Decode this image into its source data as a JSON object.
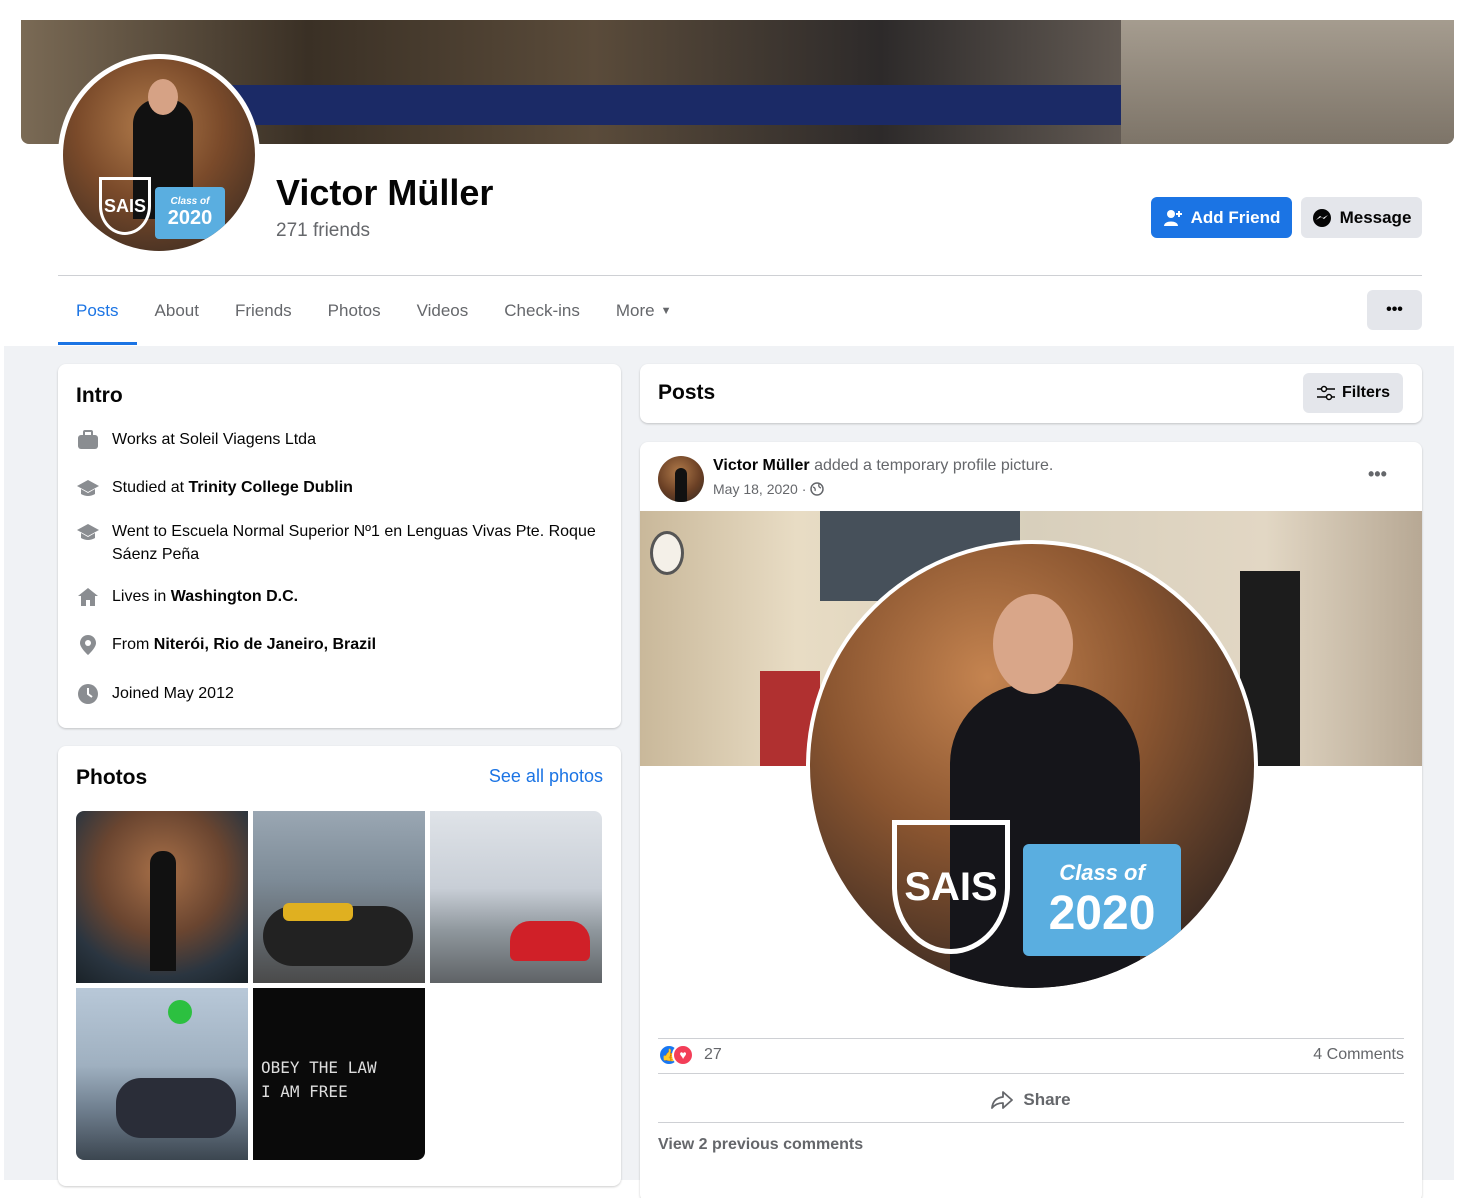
{
  "profile": {
    "name": "Victor Müller",
    "friends": "271 friends",
    "add_friend": "Add Friend",
    "message": "Message"
  },
  "badge": {
    "sais": "SAIS",
    "class_of": "Class of",
    "year": "2020"
  },
  "tabs": [
    {
      "label": "Posts",
      "active": true
    },
    {
      "label": "About"
    },
    {
      "label": "Friends"
    },
    {
      "label": "Photos"
    },
    {
      "label": "Videos"
    },
    {
      "label": "Check-ins"
    },
    {
      "label": "More"
    }
  ],
  "more_dots": "•••",
  "intro": {
    "title": "Intro",
    "items": [
      {
        "icon": "briefcase-icon",
        "prefix": "Works at Soleil Viagens Ltda",
        "bold": ""
      },
      {
        "icon": "graduation-cap-icon",
        "prefix": "Studied at ",
        "bold": "Trinity College Dublin"
      },
      {
        "icon": "graduation-cap-icon",
        "prefix": "Went to Escuela Normal Superior Nº1 en Lenguas Vivas Pte. Roque Sáenz Peña",
        "bold": ""
      },
      {
        "icon": "home-icon",
        "prefix": "Lives in ",
        "bold": "Washington D.C."
      },
      {
        "icon": "location-pin-icon",
        "prefix": "From ",
        "bold": "Niterói, Rio de Janeiro, Brazil"
      },
      {
        "icon": "clock-icon",
        "prefix": "Joined May 2012",
        "bold": ""
      }
    ]
  },
  "photos": {
    "title": "Photos",
    "see_all": "See all photos",
    "poster_lines": [
      "OBEY THE LAW",
      "I AM FREE"
    ]
  },
  "posts": {
    "title": "Posts",
    "filters": "Filters"
  },
  "post": {
    "author": "Victor Müller",
    "action": " added a temporary profile picture.",
    "date": "May 18, 2020 ·",
    "reaction_count": "27",
    "comments": "4 Comments",
    "share": "Share",
    "previous_comments": "View 2 previous comments"
  },
  "colors": {
    "accent": "#1b74e4",
    "secondary_text": "#65676b",
    "feed_bg": "#f0f2f5"
  }
}
